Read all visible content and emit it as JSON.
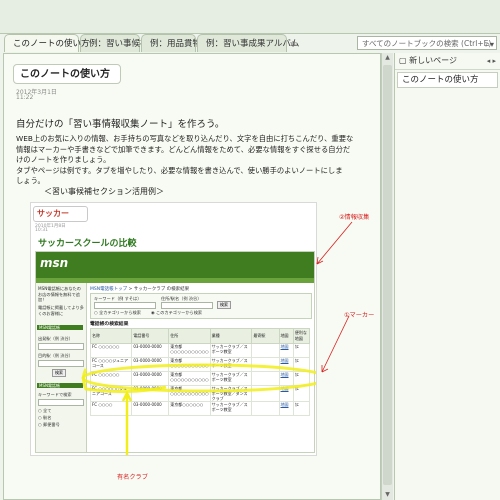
{
  "tabs": [
    {
      "label": "このノートの使い方",
      "active": true
    },
    {
      "label": "例：習い事候補",
      "active": false
    },
    {
      "label": "例：用品貫物",
      "active": false
    },
    {
      "label": "例：習い事成果アルバム",
      "active": false
    }
  ],
  "search": {
    "placeholder": "すべてのノートブックの検索 (Ctrl+E)",
    "icon": "search-icon"
  },
  "sidebar": {
    "new_page_label": "新しいページ",
    "items": [
      {
        "label": "このノートの使い方"
      }
    ]
  },
  "page": {
    "title": "このノートの使い方",
    "date": "2012年3月1日",
    "time": "11:22",
    "heading": "自分だけの「習い事情報収集ノート」を作ろう。",
    "body_lines": [
      "WEB上のお気に入りの情報、お手持ちの写真などを取り込んだり、文字を自由に打ちこんだり、重要な",
      "情報はマーカーや手書きなどで加筆できます。どんどん情報をためて、必要な情報をすぐ探せる自分だ",
      "けのノートを作りましょう。",
      "タブやページは例です。タブを増やしたり、必要な情報を書き込んで、使い勝手のよいノートにしま",
      "しょう。"
    ],
    "section_label": "＜習い事候補セクション活用例＞"
  },
  "example": {
    "title": "サッカー",
    "date": "2010年1月8日",
    "time": "10:31",
    "heading": "サッカースクールの比較",
    "msn": {
      "logo": "msn",
      "breadcrumb_link": "MSN電話帳トップ",
      "breadcrumb_rest": " > サッカークラブ の検索結果",
      "form": {
        "keyword_label": "キーワード（例 すそは）",
        "area_label": "住所/駅名（例 渋谷）",
        "search_button": "検索",
        "radio_all": "全カテゴリーから検索",
        "radio_cat": "このカテゴリーから検索"
      },
      "left": {
        "promo": "MSN電話帳にあなたのお店の情報を無料で追加！",
        "promo2": "電話帳に掲載してより多くのお客様に",
        "head1": "MSN電話帳",
        "area_label": "出発駅（例 渋谷）",
        "station_label": "目的駅（例 渋谷）",
        "button": "検索",
        "head2": "MSN電話帳",
        "keyword_label": "キーワードで検索",
        "opt1": "全て",
        "opt2": "駅名",
        "opt3": "郵便番号"
      },
      "results_title": "電話帳の検索結果",
      "columns": [
        "名称",
        "電話番号",
        "住所",
        "業種",
        "最寄駅",
        "地図",
        "便利な地図"
      ],
      "rows": [
        [
          "FC ○○○○○○",
          "03-0000-0000",
          "東京都○○○○○○○○○○○",
          "サッカークラブ／スポーツ教室",
          "",
          "地図",
          "ｶｴ"
        ],
        [
          "FC ○○○○ジュニアコース",
          "03-0000-0000",
          "東京都○○○○○○○○○○○",
          "サッカークラブ／スポーツ教室",
          "",
          "地図",
          "ｶｴ"
        ],
        [
          "FC ○○○○○○",
          "03-0000-0000",
          "東京都○○○○○○○○○○○",
          "サッカークラブ／スポーツ教室",
          "",
          "地図",
          "ｶｴ"
        ],
        [
          "FC ○○○○○○ジュニアコース",
          "03-0000-0000",
          "東京都○○○○○○○○○○○",
          "サッカークラブ／スポーツ教室／ダンスクラブ",
          "",
          "地図",
          "ｶｴ"
        ],
        [
          "FC ○○○○",
          "03-0000-0000",
          "東京都○○○○○○",
          "サッカークラブ／スポーツ教室",
          "",
          "地図",
          "ｶｴ"
        ]
      ]
    }
  },
  "annotations": {
    "info": "②情報収集",
    "marker": "①マーカー",
    "famous": "有名クラブ"
  },
  "colors": {
    "annotation": "#d61f1f",
    "highlight": "#f2ee1a",
    "msn_green": "#3f7d20"
  }
}
